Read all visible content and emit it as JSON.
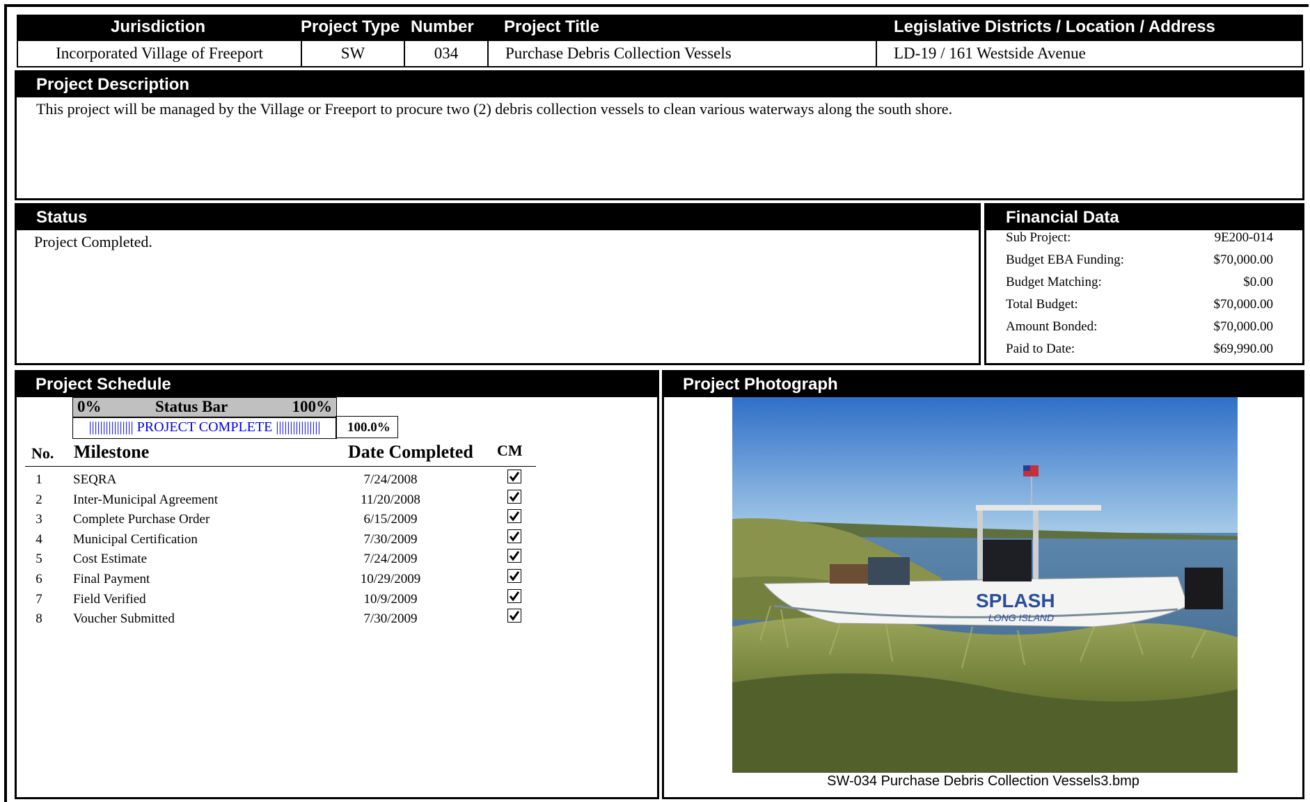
{
  "header": {
    "columns": {
      "jurisdiction": "Jurisdiction",
      "project_type": "Project Type",
      "number": "Number",
      "project_title": "Project Title",
      "location": "Legislative Districts / Location / Address"
    },
    "values": {
      "jurisdiction": "Incorporated Village of Freeport",
      "project_type": "SW",
      "number": "034",
      "project_title": "Purchase Debris Collection Vessels",
      "location": "LD-19 / 161 Westside Avenue"
    }
  },
  "description": {
    "title": "Project Description",
    "text": "This project will be managed by the Village or Freeport to procure two (2) debris collection vessels to clean various waterways along the south shore."
  },
  "status": {
    "title": "Status",
    "text": "Project Completed."
  },
  "financial": {
    "title": "Financial Data",
    "rows": [
      {
        "label": "Sub Project:",
        "value": "9E200-014"
      },
      {
        "label": "Budget EBA Funding:",
        "value": "$70,000.00"
      },
      {
        "label": "Budget Matching:",
        "value": "$0.00"
      },
      {
        "label": "Total Budget:",
        "value": "$70,000.00"
      },
      {
        "label": "Amount Bonded:",
        "value": "$70,000.00"
      },
      {
        "label": "Paid to Date:",
        "value": "$69,990.00"
      }
    ]
  },
  "schedule": {
    "title": "Project Schedule",
    "status_bar": {
      "left": "0%",
      "label": "Status Bar",
      "right": "100%",
      "progress_text": "|||||||||||||||| PROJECT COMPLETE ||||||||||||||||",
      "percent_text": "100.0%",
      "percent": 100.0
    },
    "columns": {
      "no": "No.",
      "milestone": "Milestone",
      "date": "Date Completed",
      "cm": "CM"
    },
    "milestones": [
      {
        "no": "1",
        "name": "SEQRA",
        "date": "7/24/2008",
        "cm": true
      },
      {
        "no": "2",
        "name": "Inter-Municipal Agreement",
        "date": "11/20/2008",
        "cm": true
      },
      {
        "no": "3",
        "name": "Complete Purchase Order",
        "date": "6/15/2009",
        "cm": true
      },
      {
        "no": "4",
        "name": "Municipal Certification",
        "date": "7/30/2009",
        "cm": true
      },
      {
        "no": "5",
        "name": "Cost Estimate",
        "date": "7/24/2009",
        "cm": true
      },
      {
        "no": "6",
        "name": "Final Payment",
        "date": "10/29/2009",
        "cm": true
      },
      {
        "no": "7",
        "name": "Field Verified",
        "date": "10/9/2009",
        "cm": true
      },
      {
        "no": "8",
        "name": "Voucher Submitted",
        "date": "7/30/2009",
        "cm": true
      }
    ]
  },
  "photograph": {
    "title": "Project Photograph",
    "caption": "SW-034 Purchase Debris Collection Vessels3.bmp",
    "boat_text": "SPLASH",
    "boat_subtext": "LONG ISLAND"
  }
}
